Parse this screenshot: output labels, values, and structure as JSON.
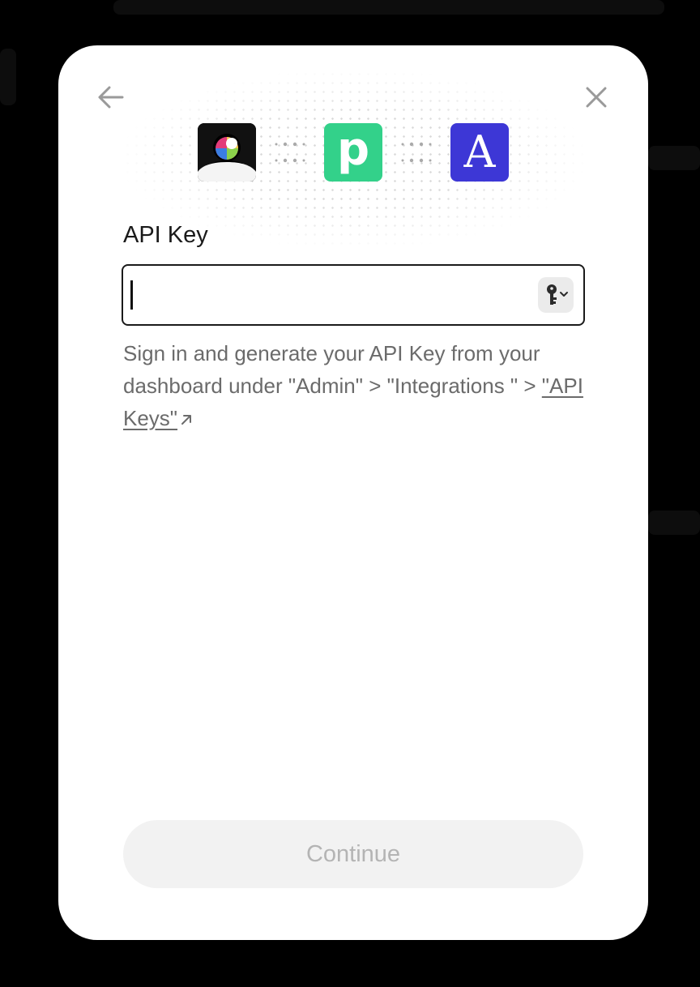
{
  "dialog": {
    "back_icon": "arrow-left-icon",
    "close_icon": "close-icon",
    "logos": [
      {
        "name": "app-logo",
        "glyph": ""
      },
      {
        "name": "pipedrive-logo",
        "glyph": "p",
        "color": "#33d18a"
      },
      {
        "name": "attio-logo",
        "glyph": "A",
        "color": "#3d37d6"
      }
    ],
    "field_label": "API Key",
    "input_value": "",
    "key_icon": "key-chevron-icon",
    "help_text": "Sign in and generate your API Key from your dashboard under \"Admin\" > \"Integrations \" > ",
    "help_link": "\"API Keys\"",
    "help_link_icon": "external-arrow-icon",
    "continue_label": "Continue"
  }
}
